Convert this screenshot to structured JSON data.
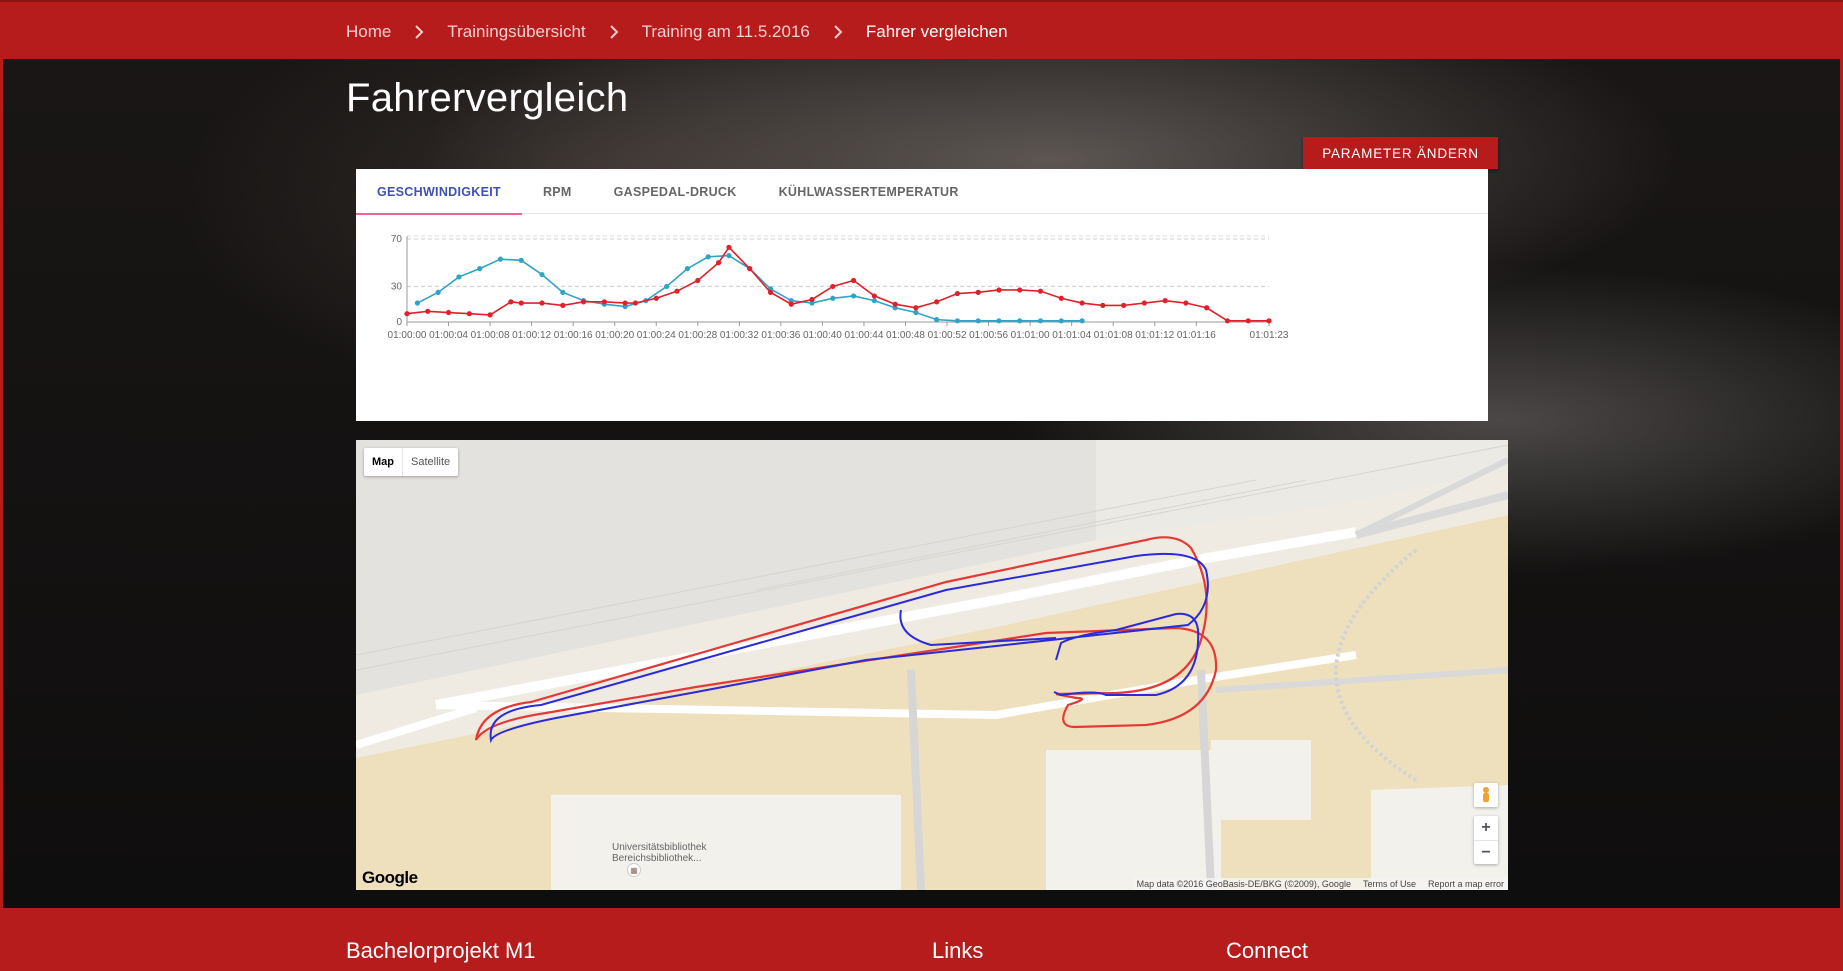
{
  "breadcrumb": {
    "items": [
      "Home",
      "Trainingsübersicht",
      "Training am 11.5.2016",
      "Fahrer vergleichen"
    ]
  },
  "page": {
    "title": "Fahrervergleich",
    "param_button": "Parameter ändern"
  },
  "tabs": [
    {
      "label": "Geschwindigkeit",
      "active": true
    },
    {
      "label": "RPM",
      "active": false
    },
    {
      "label": "Gaspedal-Druck",
      "active": false
    },
    {
      "label": "Kühlwassertemperatur",
      "active": false
    }
  ],
  "chart_data": {
    "type": "line",
    "title": "",
    "xlabel": "",
    "ylabel": "",
    "ylim": [
      0,
      70
    ],
    "yticks": [
      0,
      30,
      70
    ],
    "grid": true,
    "x_ticks": [
      "01:00:00",
      "01:00:04",
      "01:00:08",
      "01:00:12",
      "01:00:16",
      "01:00:20",
      "01:00:24",
      "01:00:28",
      "01:00:32",
      "01:00:36",
      "01:00:40",
      "01:00:44",
      "01:00:48",
      "01:00:52",
      "01:00:56",
      "01:01:00",
      "01:01:04",
      "01:01:08",
      "01:01:12",
      "01:01:16",
      "01:01:23"
    ],
    "x_range_seconds": [
      0,
      83
    ],
    "series": [
      {
        "color": "#2fa4c7",
        "x": [
          1,
          3,
          5,
          7,
          9,
          11,
          13,
          15,
          17,
          19,
          21,
          23,
          25,
          27,
          29,
          31,
          33,
          35,
          37,
          39,
          41,
          43,
          45,
          47,
          49,
          51,
          53,
          55,
          57,
          59,
          61,
          63,
          65
        ],
        "values": [
          16,
          25,
          38,
          45,
          53,
          52,
          40,
          25,
          18,
          15,
          13,
          18,
          30,
          45,
          55,
          56,
          45,
          28,
          18,
          16,
          20,
          22,
          18,
          12,
          8,
          2,
          1,
          1,
          1,
          1,
          1,
          1,
          1
        ]
      },
      {
        "color": "#e0202a",
        "x": [
          0,
          2,
          4,
          6,
          8,
          10,
          11,
          13,
          15,
          17,
          19,
          21,
          22,
          24,
          26,
          28,
          30,
          31,
          33,
          35,
          37,
          39,
          41,
          43,
          45,
          47,
          49,
          51,
          53,
          55,
          57,
          59,
          61,
          63,
          65,
          67,
          69,
          71,
          73,
          75,
          77,
          79,
          81,
          83
        ],
        "values": [
          7,
          9,
          8,
          7,
          6,
          17,
          16,
          16,
          14,
          17,
          17,
          16,
          16,
          20,
          26,
          35,
          50,
          63,
          45,
          25,
          15,
          19,
          30,
          35,
          22,
          15,
          12,
          17,
          24,
          25,
          27,
          27,
          26,
          20,
          16,
          14,
          14,
          16,
          18,
          16,
          12,
          1,
          1,
          1
        ]
      }
    ]
  },
  "map": {
    "type_buttons": [
      "Map",
      "Satellite"
    ],
    "active_type": "Map",
    "zoom_in": "+",
    "zoom_out": "−",
    "google_logo": "Google",
    "poi_line1": "Universitätsbibliothek",
    "poi_line2": "Bereichsbibliothek...",
    "attribution": "Map data ©2016 GeoBasis-DE/BKG (©2009), Google",
    "terms": "Terms of Use",
    "report": "Report a map error",
    "track_colors": {
      "driver_a": "#e53935",
      "driver_b": "#2b2bd9"
    }
  },
  "footer": {
    "col1": "Bachelorprojekt M1",
    "col2": "Links",
    "col3": "Connect"
  }
}
